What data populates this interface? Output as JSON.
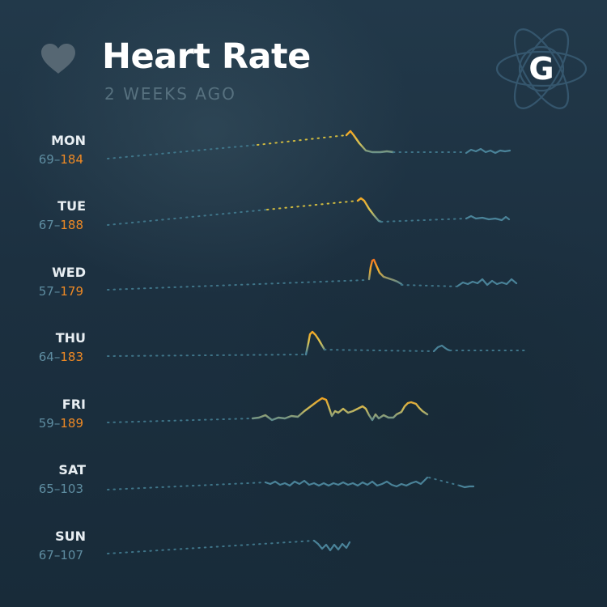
{
  "header": {
    "title": "Heart Rate",
    "subtitle": "2 WEEKS AGO",
    "logo_letter": "G"
  },
  "icons": {
    "heart": "heart-icon",
    "logo": "atom-logo-icon"
  },
  "colors": {
    "background": "#1b2e3b",
    "title": "#ffffff",
    "subtitle": "#57717f",
    "resting": "#4a8399",
    "peak": "#f6a71d",
    "range_max": "#f08a24"
  },
  "days": [
    {
      "day": "MON",
      "min": "69",
      "sep": "–",
      "max": "184"
    },
    {
      "day": "TUE",
      "min": "67",
      "sep": "–",
      "max": "188"
    },
    {
      "day": "WED",
      "min": "57",
      "sep": "–",
      "max": "179"
    },
    {
      "day": "THU",
      "min": "64",
      "sep": "–",
      "max": "183"
    },
    {
      "day": "FRI",
      "min": "59",
      "sep": "–",
      "max": "189"
    },
    {
      "day": "SAT",
      "min": "65",
      "sep": "–",
      "max": "103"
    },
    {
      "day": "SUN",
      "min": "67",
      "sep": "–",
      "max": "107"
    }
  ]
}
